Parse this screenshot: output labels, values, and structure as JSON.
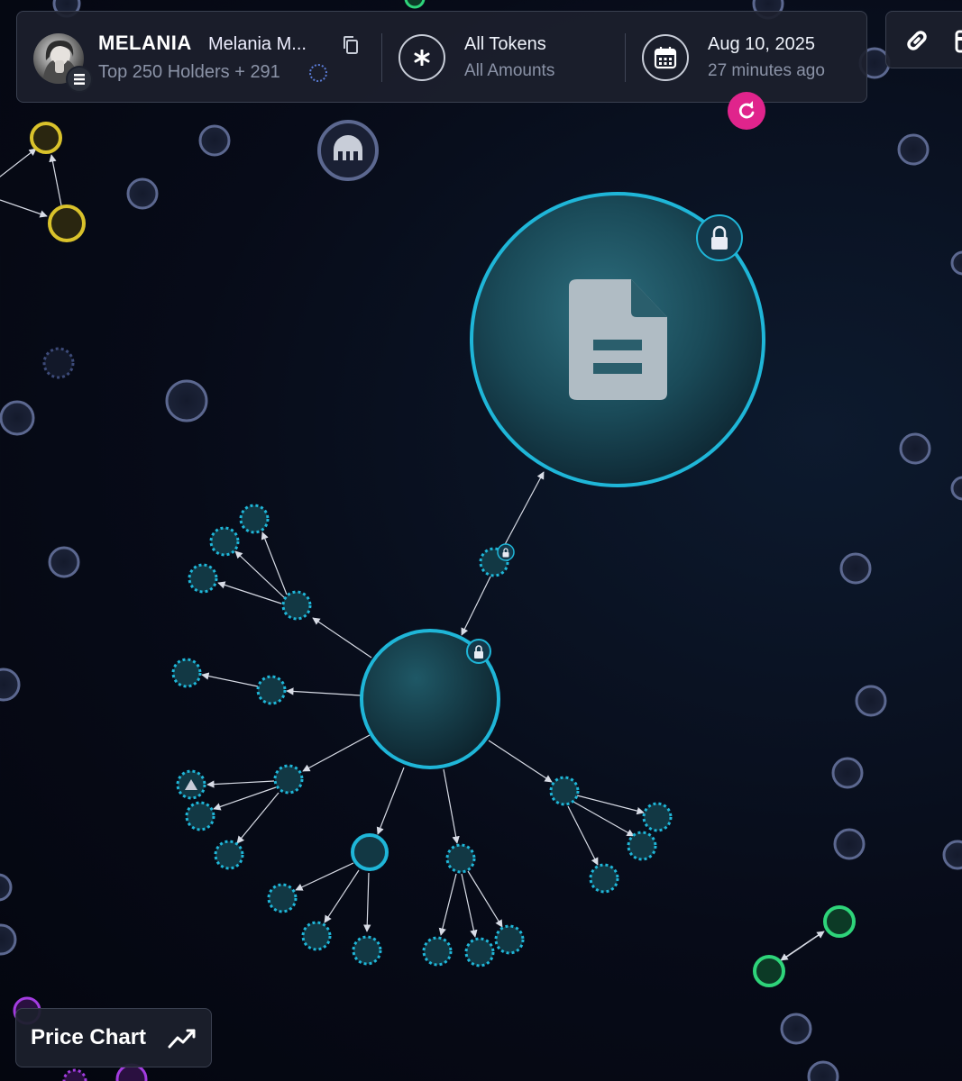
{
  "token": {
    "symbol": "MELANIA",
    "name": "Melania M...",
    "holders_text": "Top 250 Holders + 291",
    "avatar_icon": "profile-photo",
    "chain_icon": "solana-icon"
  },
  "tokens_filter": {
    "main": "All Tokens",
    "sub": "All Amounts",
    "icon": "asterisk-icon"
  },
  "date_filter": {
    "main": "Aug 10, 2025",
    "sub": "27 minutes ago",
    "icon": "calendar-icon"
  },
  "price_chart_button": {
    "label": "Price Chart",
    "icon": "trend-line-icon"
  },
  "colors": {
    "cyan": "#1fb6d8",
    "cyan_fill": "#123844",
    "yellow": "#d9c22b",
    "green": "#2ed47a",
    "purple": "#a33ce0",
    "grey_node": "#5c6890",
    "refresh_pink": "#e0248c"
  }
}
